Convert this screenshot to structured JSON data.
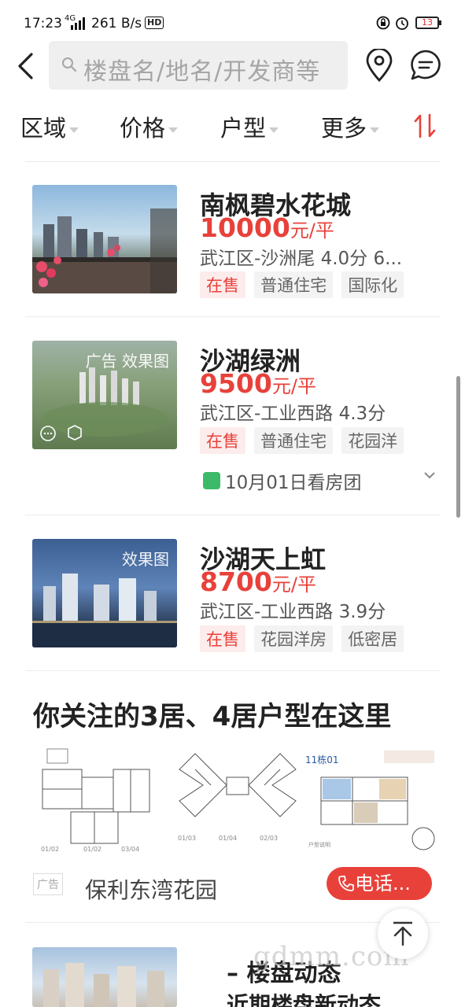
{
  "status_bar": {
    "time": "17:23",
    "network": "4G",
    "speed": "261 B/s",
    "hd": "HD",
    "battery": "13"
  },
  "search": {
    "placeholder": "楼盘名/地名/开发商等"
  },
  "filters": [
    {
      "label": "区域"
    },
    {
      "label": "价格"
    },
    {
      "label": "户型"
    },
    {
      "label": "更多"
    }
  ],
  "listings": [
    {
      "name": "南枫碧水花城",
      "price": "10000",
      "unit": "元/平",
      "meta": "武江区-沙洲尾 4.0分 6...",
      "tags": [
        "在售",
        "普通住宅",
        "国际化"
      ],
      "badge": ""
    },
    {
      "name": "沙湖绿洲",
      "price": "9500",
      "unit": "元/平",
      "meta": "武江区-工业西路 4.3分",
      "tags": [
        "在售",
        "普通住宅",
        "花园洋"
      ],
      "badge": "广告 效果图",
      "tour": "10月01日看房团"
    },
    {
      "name": "沙湖天上虹",
      "price": "8700",
      "unit": "元/平",
      "meta": "武江区-工业西路 3.9分",
      "tags": [
        "在售",
        "花园洋房",
        "低密居"
      ],
      "badge": "效果图"
    }
  ],
  "recommendation": {
    "title": "你关注的3居、4居户型在这里",
    "ad_label": "广告",
    "name": "保利东湾花园",
    "call_label": "电话..."
  },
  "bottom": {
    "title": "楼盘动态",
    "subtitle": "近期楼盘新动态",
    "watermark": "gdmm.com"
  },
  "colors": {
    "accent": "#e8413a",
    "tour_icon": "#3cba6a"
  }
}
